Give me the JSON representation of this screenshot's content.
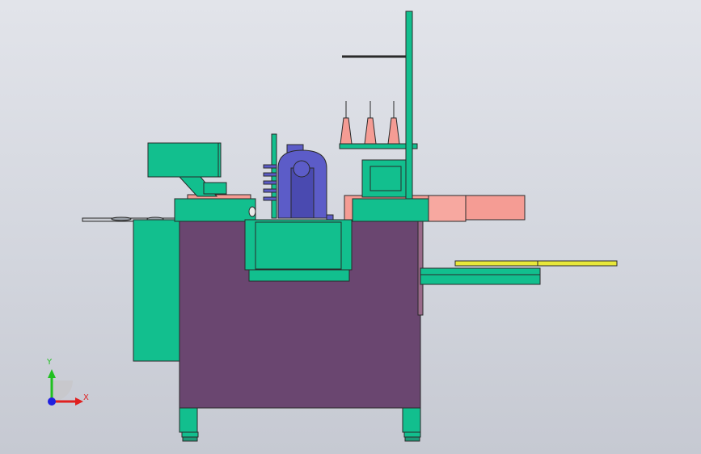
{
  "viewport": {
    "background_top": "#e2e4ea",
    "background_bottom": "#c6c9d2"
  },
  "colors": {
    "frame_green": "#12bf8e",
    "cabinet_purple": "#6a4670",
    "table_pink": "#f59c94",
    "motor_blue": "#5c5cc8",
    "tray_yellow": "#e8e83a",
    "edge": "#2a2a2a"
  },
  "triad": {
    "x_label": "X",
    "y_label": "Y",
    "x_color": "#e02020",
    "y_color": "#20c020",
    "origin_color": "#2020e0",
    "icon": "coordinate-triad-icon"
  }
}
